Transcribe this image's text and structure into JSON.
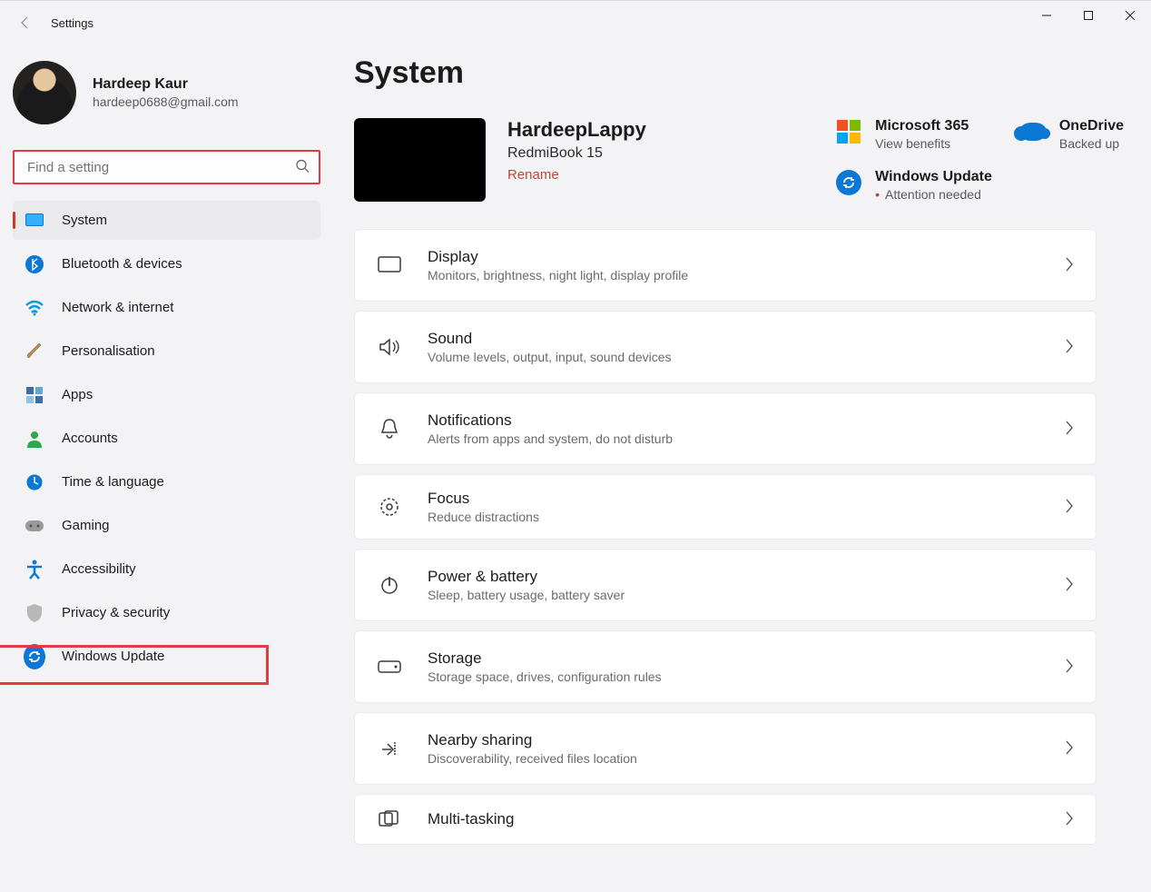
{
  "window": {
    "title": "Settings"
  },
  "profile": {
    "name": "Hardeep Kaur",
    "email": "hardeep0688@gmail.com"
  },
  "search": {
    "placeholder": "Find a setting"
  },
  "sidebar": {
    "items": [
      {
        "label": "System"
      },
      {
        "label": "Bluetooth & devices"
      },
      {
        "label": "Network & internet"
      },
      {
        "label": "Personalisation"
      },
      {
        "label": "Apps"
      },
      {
        "label": "Accounts"
      },
      {
        "label": "Time & language"
      },
      {
        "label": "Gaming"
      },
      {
        "label": "Accessibility"
      },
      {
        "label": "Privacy & security"
      },
      {
        "label": "Windows Update"
      }
    ]
  },
  "page": {
    "title": "System",
    "device": {
      "name": "HardeepLappy",
      "model": "RedmiBook 15",
      "rename": "Rename"
    },
    "quick": {
      "m365": {
        "title": "Microsoft 365",
        "sub": "View benefits"
      },
      "od": {
        "title": "OneDrive",
        "sub": "Backed up"
      },
      "wu": {
        "title": "Windows Update",
        "sub": "Attention needed"
      }
    },
    "cards": [
      {
        "title": "Display",
        "desc": "Monitors, brightness, night light, display profile"
      },
      {
        "title": "Sound",
        "desc": "Volume levels, output, input, sound devices"
      },
      {
        "title": "Notifications",
        "desc": "Alerts from apps and system, do not disturb"
      },
      {
        "title": "Focus",
        "desc": "Reduce distractions"
      },
      {
        "title": "Power & battery",
        "desc": "Sleep, battery usage, battery saver"
      },
      {
        "title": "Storage",
        "desc": "Storage space, drives, configuration rules"
      },
      {
        "title": "Nearby sharing",
        "desc": "Discoverability, received files location"
      },
      {
        "title": "Multi-tasking",
        "desc": ""
      }
    ]
  }
}
